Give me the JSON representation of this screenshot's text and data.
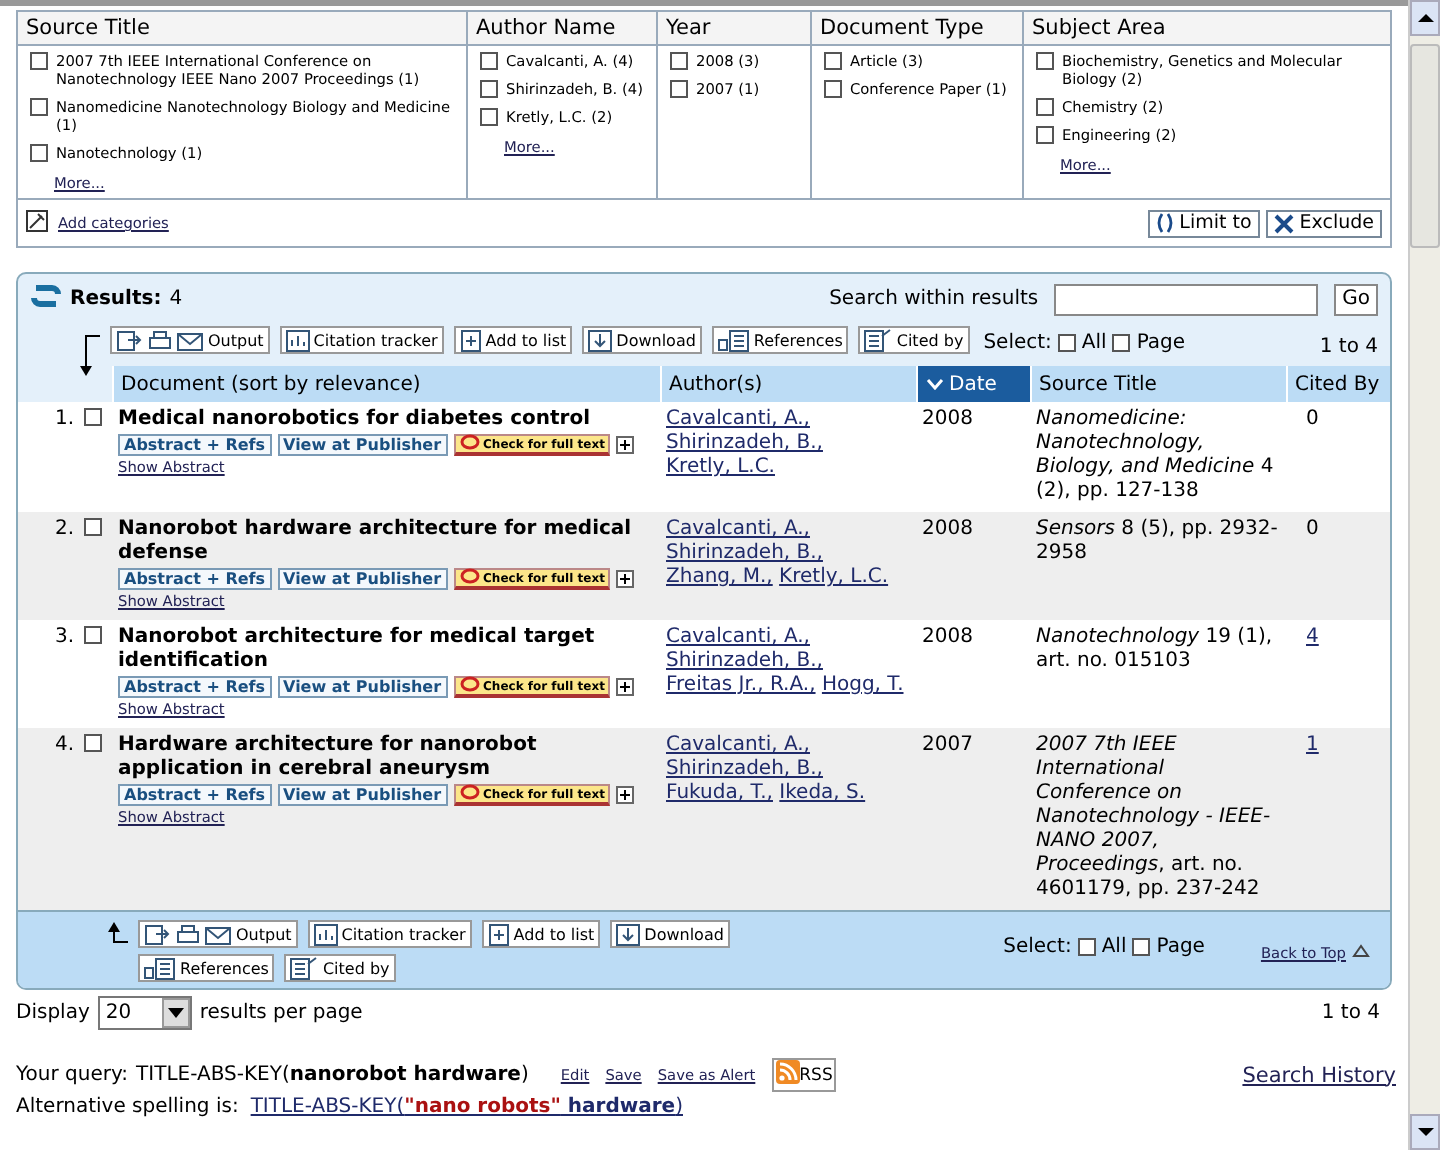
{
  "facets": [
    {
      "title": "Source Title",
      "options": [
        {
          "label": "2007 7th IEEE International Conference on Nanotechnology IEEE Nano 2007 Proceedings (1)",
          "checked": false
        },
        {
          "label": "Nanomedicine Nanotechnology Biology and Medicine (1)",
          "checked": false
        },
        {
          "label": "Nanotechnology (1)",
          "checked": false
        }
      ],
      "more": "More..."
    },
    {
      "title": "Author Name",
      "options": [
        {
          "label": "Cavalcanti, A. (4)",
          "checked": false
        },
        {
          "label": "Shirinzadeh, B. (4)",
          "checked": false
        },
        {
          "label": "Kretly, L.C. (2)",
          "checked": false
        }
      ],
      "more": "More..."
    },
    {
      "title": "Year",
      "options": [
        {
          "label": "2008 (3)",
          "checked": false
        },
        {
          "label": "2007 (1)",
          "checked": false
        }
      ]
    },
    {
      "title": "Document Type",
      "options": [
        {
          "label": "Article (3)",
          "checked": false
        },
        {
          "label": "Conference Paper (1)",
          "checked": false
        }
      ]
    },
    {
      "title": "Subject Area",
      "options": [
        {
          "label": "Biochemistry, Genetics and Molecular Biology (2)",
          "checked": false
        },
        {
          "label": "Chemistry (2)",
          "checked": false
        },
        {
          "label": "Engineering (2)",
          "checked": false
        }
      ],
      "more": "More..."
    }
  ],
  "facet_actions": {
    "add_categories": "Add categories",
    "limit": "Limit to",
    "exclude": "Exclude"
  },
  "results": {
    "label": "Results:",
    "count": "4",
    "search_label": "Search within results",
    "go": "Go",
    "range": "1 to 4",
    "toolbar": [
      {
        "label": "Output",
        "kind": "output"
      },
      {
        "label": "Citation tracker",
        "kind": "tracker"
      },
      {
        "label": "Add to list",
        "kind": "list"
      },
      {
        "label": "Download",
        "kind": "download"
      },
      {
        "label": "References",
        "kind": "references"
      },
      {
        "label": "Cited by",
        "kind": "citedby"
      }
    ],
    "select": {
      "label": "Select:",
      "all": {
        "label": "All",
        "checked": false
      },
      "page": {
        "label": "Page",
        "checked": false
      }
    },
    "columns": [
      {
        "label": "Document (sort by relevance)",
        "sorted": false
      },
      {
        "label": "Author(s)",
        "sorted": false
      },
      {
        "label": "Date",
        "sorted": true
      },
      {
        "label": "Source Title",
        "sorted": false
      },
      {
        "label": "Cited By",
        "sorted": false
      }
    ],
    "rows": [
      {
        "number": "1.",
        "checked": false,
        "title": "Medical nanorobotics for diabetes control",
        "actions": [
          "Abstract + Refs",
          "View at Publisher",
          "Check for full text"
        ],
        "show_abstract": "Show Abstract",
        "authors": [
          "Cavalcanti, A.,",
          "Shirinzadeh, B.,",
          "Kretly, L.C."
        ],
        "year": "2008",
        "source": "*Nanomedicine: Nanotechnology, Biology, and Medicine* 4 (2), pp. 127-138",
        "cited_by": "0",
        "cited_linked": false
      },
      {
        "number": "2.",
        "checked": false,
        "title": "Nanorobot hardware architecture for medical defense",
        "actions": [
          "Abstract + Refs",
          "View at Publisher",
          "Check for full text"
        ],
        "show_abstract": "Show Abstract",
        "authors": [
          "Cavalcanti, A.,",
          "Shirinzadeh, B.,",
          "Zhang, M.,",
          "Kretly, L.C."
        ],
        "year": "2008",
        "source": "*Sensors* 8 (5), pp. 2932-2958",
        "cited_by": "0",
        "cited_linked": false
      },
      {
        "number": "3.",
        "checked": false,
        "title": "Nanorobot architecture for medical target identification",
        "actions": [
          "Abstract + Refs",
          "View at Publisher",
          "Check for full text"
        ],
        "show_abstract": "Show Abstract",
        "authors": [
          "Cavalcanti, A.,",
          "Shirinzadeh, B.,",
          "Freitas Jr., R.A.,",
          "Hogg, T."
        ],
        "year": "2008",
        "source": "*Nanotechnology* 19 (1), art. no. 015103",
        "cited_by": "4",
        "cited_linked": true
      },
      {
        "number": "4.",
        "checked": false,
        "title": "Hardware architecture for nanorobot application in cerebral aneurysm",
        "actions": [
          "Abstract + Refs",
          "View at Publisher",
          "Check for full text"
        ],
        "show_abstract": "Show Abstract",
        "authors": [
          "Cavalcanti, A.,",
          "Shirinzadeh, B.,",
          "Fukuda, T.,",
          "Ikeda, S."
        ],
        "year": "2007",
        "source": "*2007 7th IEEE International Conference on Nanotechnology - IEEE-NANO 2007, Proceedings*, art. no. 4601179, pp. 237-242",
        "cited_by": "1",
        "cited_linked": true
      }
    ],
    "bottom_toolbar": [
      {
        "label": "Output",
        "kind": "output"
      },
      {
        "label": "Citation tracker",
        "kind": "tracker"
      },
      {
        "label": "Add to list",
        "kind": "list"
      },
      {
        "label": "Download",
        "kind": "download"
      },
      {
        "label": "References",
        "kind": "references"
      },
      {
        "label": "Cited by",
        "kind": "citedby"
      }
    ],
    "bottom_select": {
      "label": "Select:",
      "all": {
        "label": "All",
        "checked": false
      },
      "page": {
        "label": "Page",
        "checked": false
      }
    },
    "back_to_top": "Back to Top"
  },
  "display": {
    "label": "Display",
    "value": "20",
    "suffix": "results per page",
    "range": "1 to 4"
  },
  "query": {
    "label": "Your query:",
    "text": "TITLE-ABS-KEY(**nanorobot hardware**)",
    "links": [
      "Edit",
      "Save",
      "Save as Alert"
    ],
    "rss": "RSS",
    "history": "Search History"
  },
  "alternative": {
    "label": "Alternative spelling is:",
    "parts": [
      {
        "text": "TITLE-ABS-KEY(",
        "kind": "plain"
      },
      {
        "text": "\"nano robots\"",
        "kind": "correction"
      },
      {
        "text": " hardware",
        "kind": "term"
      },
      {
        "text": ")",
        "kind": "plain"
      }
    ]
  }
}
